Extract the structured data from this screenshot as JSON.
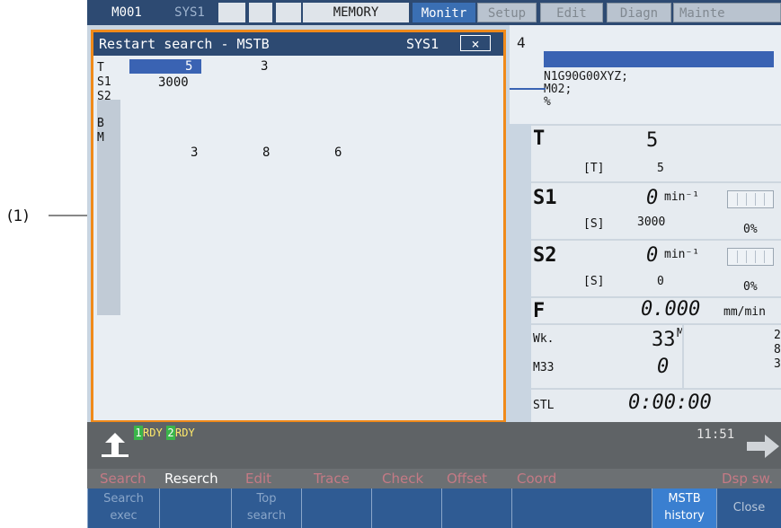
{
  "callout": {
    "label": "(1)"
  },
  "topbar": {
    "program": "M001",
    "system": "SYS1",
    "mode": "MEMORY",
    "tabs": [
      "Monitr",
      "Setup",
      "Edit",
      "Diagn",
      "Mainte"
    ],
    "active_tab": "Monitr"
  },
  "dialog": {
    "title": "Restart search - MSTB",
    "system": "SYS1",
    "close": "×",
    "rows": [
      {
        "label": "T",
        "values": [
          "5",
          "3"
        ]
      },
      {
        "label": "S1",
        "values": [
          "3000"
        ]
      },
      {
        "label": "S2",
        "values": []
      },
      {
        "label": "B",
        "values": []
      },
      {
        "label": "M",
        "values": [
          "3",
          "8",
          "6"
        ]
      }
    ]
  },
  "program_panel": {
    "number": "4",
    "lines": [
      "N1G90G00XYZ;",
      "M02;",
      "%"
    ]
  },
  "status": {
    "t_label": "T",
    "t_value": "5",
    "t_sub_label": "[T]",
    "t_sub_value": "5",
    "s1_label": "S1",
    "s1_value": "0",
    "s1_unit": "min⁻¹",
    "s1_sub_label": "[S]",
    "s1_sub_value": "3000",
    "s1_pct": "0%",
    "s2_label": "S2",
    "s2_value": "0",
    "s2_unit": "min⁻¹",
    "s2_sub_label": "[S]",
    "s2_sub_value": "0",
    "s2_pct": "0%",
    "f_label": "F",
    "f_value": "0.000",
    "f_unit": "mm/min",
    "wk_label": "Wk.",
    "wk_value": "33",
    "m_label": "M",
    "m_vals": [
      "2",
      "8",
      "3"
    ],
    "m33_label": "M33",
    "m33_value": "0",
    "stl_label": "STL",
    "stl_value": "0:00:00"
  },
  "modebar": {
    "rdy1_num": "1",
    "rdy1": "RDY",
    "rdy2_num": "2",
    "rdy2": "RDY",
    "time": "11:51"
  },
  "menu": [
    "Search",
    "Reserch",
    "Edit",
    "Trace",
    "Check",
    "Offset",
    "Coord",
    "Dsp sw."
  ],
  "softkeys": [
    {
      "l1": "Search",
      "l2": "exec"
    },
    {
      "l1": "",
      "l2": ""
    },
    {
      "l1": "Top",
      "l2": "search"
    },
    {
      "l1": "",
      "l2": ""
    },
    {
      "l1": "",
      "l2": ""
    },
    {
      "l1": "",
      "l2": ""
    },
    {
      "l1": "",
      "l2": ""
    },
    {
      "l1": "MSTB",
      "l2": "history"
    },
    {
      "l1": "Close",
      "l2": ""
    }
  ],
  "colors": {
    "accent": "#f08a1a",
    "title_bar": "#2d4a72",
    "rdy_green": "#3bb54a"
  }
}
